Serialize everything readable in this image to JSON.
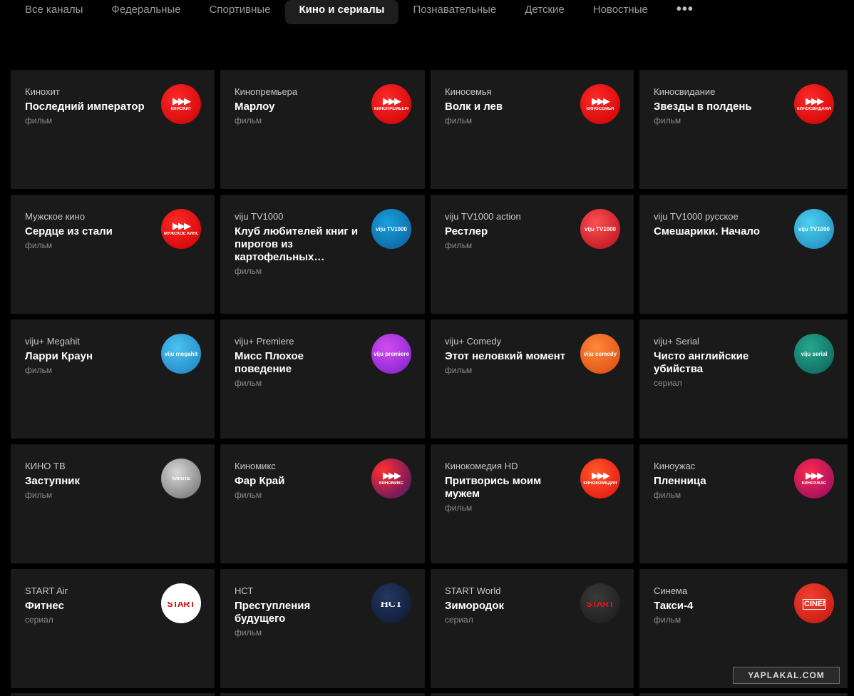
{
  "tabs": [
    {
      "label": "Все каналы",
      "active": false
    },
    {
      "label": "Федеральные",
      "active": false
    },
    {
      "label": "Спортивные",
      "active": false
    },
    {
      "label": "Кино и сериалы",
      "active": true
    },
    {
      "label": "Познавательные",
      "active": false
    },
    {
      "label": "Детские",
      "active": false
    },
    {
      "label": "Новостные",
      "active": false
    }
  ],
  "more_label": "•••",
  "cards": [
    {
      "channel": "Кинохит",
      "program": "Последний император",
      "kind": "фильм",
      "logo": {
        "icon": "kinohit-logo",
        "style": "red",
        "text": "КИНОХИТ"
      }
    },
    {
      "channel": "Кинопремьера",
      "program": "Марлоу",
      "kind": "фильм",
      "logo": {
        "icon": "kinopremiera-logo",
        "style": "red",
        "text": "КИНОПРЕМЬЕРА"
      }
    },
    {
      "channel": "Киносемья",
      "program": "Волк и лев",
      "kind": "фильм",
      "logo": {
        "icon": "kinosemya-logo",
        "style": "red",
        "text": "КИНОСЕМЬЯ"
      }
    },
    {
      "channel": "Киносвидание",
      "program": "Звезды в полдень",
      "kind": "фильм",
      "logo": {
        "icon": "kinosvidanie-logo",
        "style": "red",
        "text": "КИНОСВИДАНИЕ"
      }
    },
    {
      "channel": "Мужское кино",
      "program": "Сердце из стали",
      "kind": "фильм",
      "logo": {
        "icon": "muzhskoe-kino-logo",
        "style": "red",
        "text": "МУЖСКОЕ КИНО"
      }
    },
    {
      "channel": "viju TV1000",
      "program": "Клуб любителей книг и пирогов из картофельных…",
      "kind": "фильм",
      "logo": {
        "icon": "viju-tv1000-logo",
        "style": "blue",
        "text": "viju TV1000"
      }
    },
    {
      "channel": "viju TV1000 action",
      "program": "Рестлер",
      "kind": "фильм",
      "logo": {
        "icon": "viju-tv1000-action-logo",
        "style": "redgrad",
        "text": "viju TV1000"
      }
    },
    {
      "channel": "viju TV1000 русское",
      "program": "Смешарики. Начало",
      "kind": "",
      "logo": {
        "icon": "viju-tv1000-russkoe-logo",
        "style": "lightblue",
        "text": "viju TV1000"
      }
    },
    {
      "channel": "viju+ Megahit",
      "program": "Ларри Краун",
      "kind": "фильм",
      "logo": {
        "icon": "viju-megahit-logo",
        "style": "skyblue",
        "text": "viju megahit"
      }
    },
    {
      "channel": "viju+ Premiere",
      "program": "Мисс Плохое поведение",
      "kind": "фильм",
      "logo": {
        "icon": "viju-premiere-logo",
        "style": "purple",
        "text": "viju premiere"
      }
    },
    {
      "channel": "viju+ Comedy",
      "program": "Этот неловкий момент",
      "kind": "фильм",
      "logo": {
        "icon": "viju-comedy-logo",
        "style": "orange",
        "text": "viju comedy"
      }
    },
    {
      "channel": "viju+ Serial",
      "program": "Чисто английские убийства",
      "kind": "сериал",
      "logo": {
        "icon": "viju-serial-logo",
        "style": "teal",
        "text": "viju serial"
      }
    },
    {
      "channel": "КИНО ТВ",
      "program": "Заступник",
      "kind": "фильм",
      "logo": {
        "icon": "kino-tv-logo",
        "style": "gray",
        "text": "КИНОТВ"
      }
    },
    {
      "channel": "Киномикс",
      "program": "Фар Край",
      "kind": "фильм",
      "logo": {
        "icon": "kinomiks-logo",
        "style": "redblue",
        "text": "КИНОМИКС"
      }
    },
    {
      "channel": "Кинокомедия HD",
      "program": "Притворись моим мужем",
      "kind": "фильм",
      "logo": {
        "icon": "kinokomediya-logo",
        "style": "redorange",
        "text": "КИНОКОМЕДИЯ"
      }
    },
    {
      "channel": "Киноужас",
      "program": "Пленница",
      "kind": "фильм",
      "logo": {
        "icon": "kinouzhas-logo",
        "style": "redpurple",
        "text": "КИНОУЖАС"
      }
    },
    {
      "channel": "START Air",
      "program": "Фитнес",
      "kind": "сериал",
      "logo": {
        "icon": "start-air-logo",
        "style": "white",
        "text": "START"
      }
    },
    {
      "channel": "НСТ",
      "program": "Преступления будущего",
      "kind": "фильм",
      "logo": {
        "icon": "nst-logo",
        "style": "navy",
        "text": "НСТ"
      }
    },
    {
      "channel": "START World",
      "program": "Зимородок",
      "kind": "сериал",
      "logo": {
        "icon": "start-world-logo",
        "style": "dark",
        "text": "START"
      }
    },
    {
      "channel": "Синема",
      "program": "Такси-4",
      "kind": "фильм",
      "logo": {
        "icon": "sinema-logo",
        "style": "cinemared",
        "text": "CINEMA"
      }
    }
  ],
  "watermark": "YAPLAKAL.COM",
  "colors": {
    "background": "#000000",
    "card": "#1a1a1a",
    "active_tab": "#1e1e1e",
    "text_primary": "#ffffff",
    "text_secondary": "#c8c8c8",
    "text_muted": "#8a8a8a"
  }
}
